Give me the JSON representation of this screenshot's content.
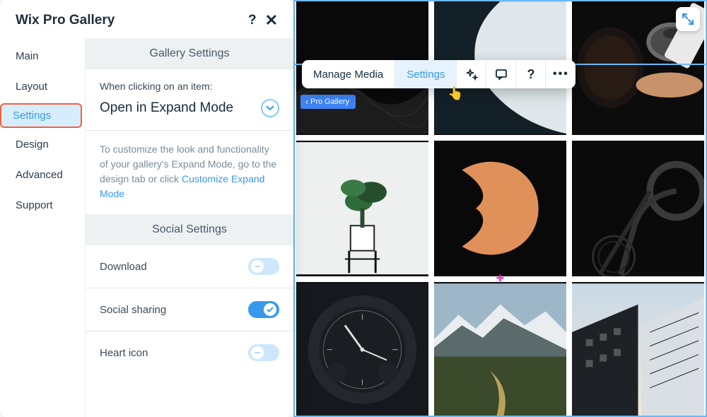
{
  "panel": {
    "title": "Wix Pro Gallery"
  },
  "sidebar": {
    "items": [
      {
        "label": "Main",
        "active": false
      },
      {
        "label": "Layout",
        "active": false
      },
      {
        "label": "Settings",
        "active": true
      },
      {
        "label": "Design",
        "active": false
      },
      {
        "label": "Advanced",
        "active": false
      },
      {
        "label": "Support",
        "active": false
      }
    ]
  },
  "sections": {
    "gallery_header": "Gallery Settings",
    "social_header": "Social Settings"
  },
  "click_action": {
    "label": "When clicking on an item:",
    "value": "Open in Expand Mode"
  },
  "help_text": {
    "prefix": "To customize the look and functionality of your gallery's Expand Mode, go to the design tab or click ",
    "link": "Customize Expand Mode"
  },
  "toggles": {
    "download": {
      "label": "Download",
      "on": false
    },
    "social_sharing": {
      "label": "Social sharing",
      "on": true
    },
    "heart_icon": {
      "label": "Heart icon",
      "on": false
    }
  },
  "editbar": {
    "manage": "Manage Media",
    "settings": "Settings"
  },
  "breadcrumb": "Pro Gallery",
  "help_q": "?",
  "help_q2": "?"
}
